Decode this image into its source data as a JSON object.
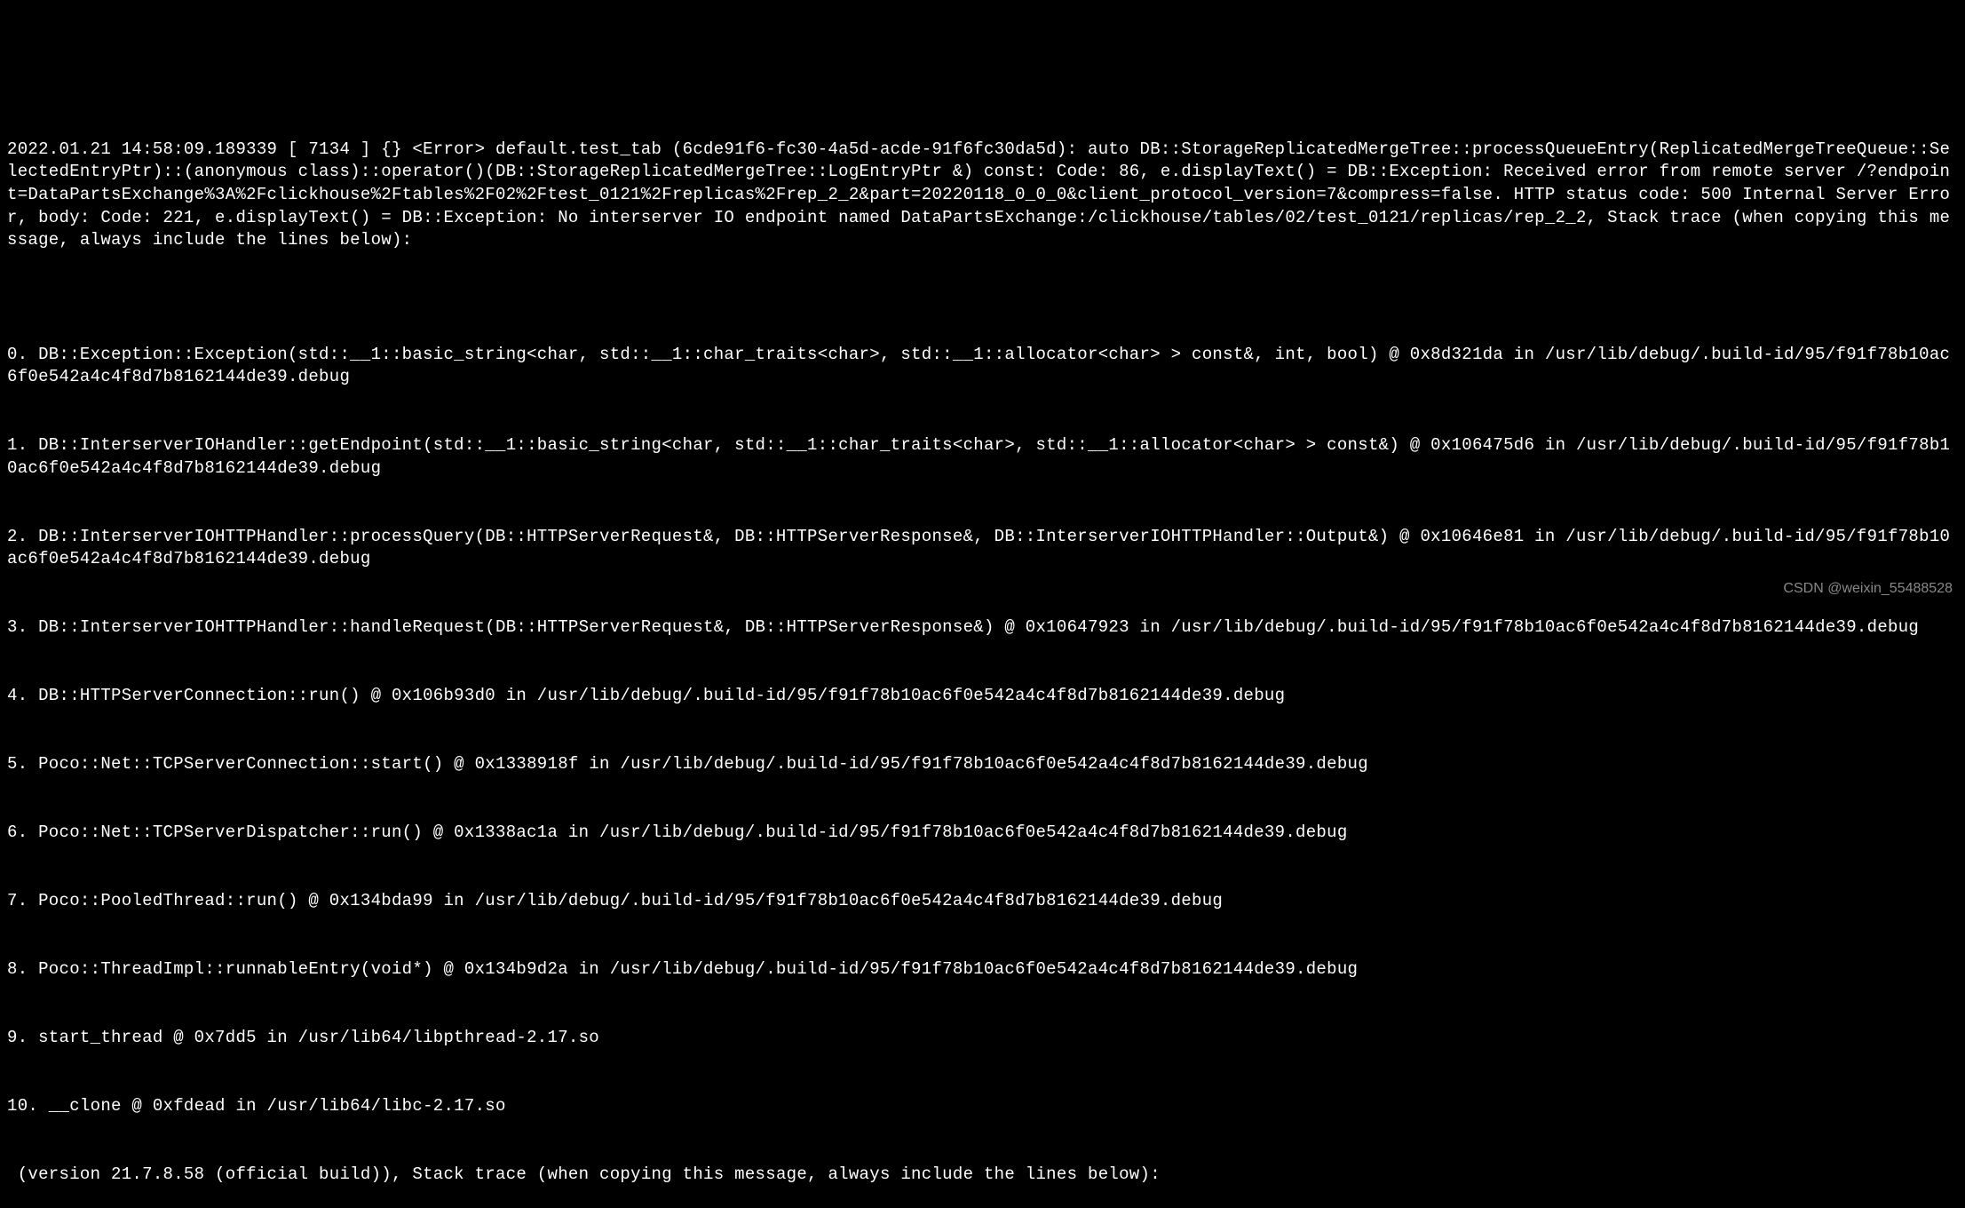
{
  "terminal": {
    "lines": [
      "2022.01.21 14:58:09.189339 [ 7134 ] {} <Error> default.test_tab (6cde91f6-fc30-4a5d-acde-91f6fc30da5d): auto DB::StorageReplicatedMergeTree::processQueueEntry(ReplicatedMergeTreeQueue::SelectedEntryPtr)::(anonymous class)::operator()(DB::StorageReplicatedMergeTree::LogEntryPtr &) const: Code: 86, e.displayText() = DB::Exception: Received error from remote server /?endpoint=DataPartsExchange%3A%2Fclickhouse%2Ftables%2F02%2Ftest_0121%2Freplicas%2Frep_2_2&part=20220118_0_0_0&client_protocol_version=7&compress=false. HTTP status code: 500 Internal Server Error, body: Code: 221, e.displayText() = DB::Exception: No interserver IO endpoint named DataPartsExchange:/clickhouse/tables/02/test_0121/replicas/rep_2_2, Stack trace (when copying this message, always include the lines below):",
      "",
      "0. DB::Exception::Exception(std::__1::basic_string<char, std::__1::char_traits<char>, std::__1::allocator<char> > const&, int, bool) @ 0x8d321da in /usr/lib/debug/.build-id/95/f91f78b10ac6f0e542a4c4f8d7b8162144de39.debug",
      "1. DB::InterserverIOHandler::getEndpoint(std::__1::basic_string<char, std::__1::char_traits<char>, std::__1::allocator<char> > const&) @ 0x106475d6 in /usr/lib/debug/.build-id/95/f91f78b10ac6f0e542a4c4f8d7b8162144de39.debug",
      "2. DB::InterserverIOHTTPHandler::processQuery(DB::HTTPServerRequest&, DB::HTTPServerResponse&, DB::InterserverIOHTTPHandler::Output&) @ 0x10646e81 in /usr/lib/debug/.build-id/95/f91f78b10ac6f0e542a4c4f8d7b8162144de39.debug",
      "3. DB::InterserverIOHTTPHandler::handleRequest(DB::HTTPServerRequest&, DB::HTTPServerResponse&) @ 0x10647923 in /usr/lib/debug/.build-id/95/f91f78b10ac6f0e542a4c4f8d7b8162144de39.debug",
      "4. DB::HTTPServerConnection::run() @ 0x106b93d0 in /usr/lib/debug/.build-id/95/f91f78b10ac6f0e542a4c4f8d7b8162144de39.debug",
      "5. Poco::Net::TCPServerConnection::start() @ 0x1338918f in /usr/lib/debug/.build-id/95/f91f78b10ac6f0e542a4c4f8d7b8162144de39.debug",
      "6. Poco::Net::TCPServerDispatcher::run() @ 0x1338ac1a in /usr/lib/debug/.build-id/95/f91f78b10ac6f0e542a4c4f8d7b8162144de39.debug",
      "7. Poco::PooledThread::run() @ 0x134bda99 in /usr/lib/debug/.build-id/95/f91f78b10ac6f0e542a4c4f8d7b8162144de39.debug",
      "8. Poco::ThreadImpl::runnableEntry(void*) @ 0x134b9d2a in /usr/lib/debug/.build-id/95/f91f78b10ac6f0e542a4c4f8d7b8162144de39.debug",
      "9. start_thread @ 0x7dd5 in /usr/lib64/libpthread-2.17.so",
      "10. __clone @ 0xfdead in /usr/lib64/libc-2.17.so",
      " (version 21.7.8.58 (official build)), Stack trace (when copying this message, always include the lines below):"
    ]
  },
  "watermark": {
    "text": "CSDN @weixin_55488528"
  }
}
